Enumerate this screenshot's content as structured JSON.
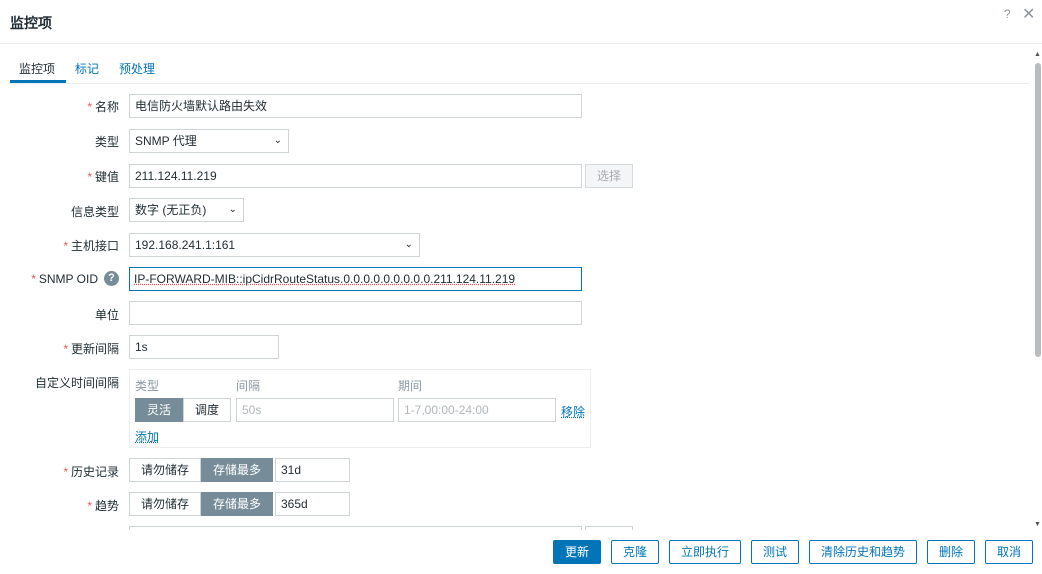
{
  "dialog": {
    "title": "监控项",
    "help_icon": "?",
    "close_icon": "✕"
  },
  "tabs": [
    {
      "label": "监控项",
      "active": true
    },
    {
      "label": "标记",
      "active": false
    },
    {
      "label": "预处理",
      "active": false
    }
  ],
  "form": {
    "name": {
      "label": "名称",
      "required": true,
      "value": "电信防火墙默认路由失效"
    },
    "type": {
      "label": "类型",
      "value": "SNMP 代理"
    },
    "key": {
      "label": "键值",
      "required": true,
      "value": "211.124.11.219",
      "select_button": "选择"
    },
    "value_type": {
      "label": "信息类型",
      "value": "数字 (无正负)"
    },
    "interface": {
      "label": "主机接口",
      "required": true,
      "value": "192.168.241.1:161"
    },
    "snmp_oid": {
      "label": "SNMP OID",
      "required": true,
      "value": "IP-FORWARD-MIB::ipCidrRouteStatus.0.0.0.0.0.0.0.0.0.211.124.11.219"
    },
    "units": {
      "label": "单位",
      "value": ""
    },
    "update_interval": {
      "label": "更新间隔",
      "required": true,
      "value": "1s"
    },
    "custom_intervals": {
      "label": "自定义时间间隔",
      "col_type": "类型",
      "col_interval": "间隔",
      "col_period": "期间",
      "flexible": "灵活",
      "scheduling": "调度",
      "interval_placeholder": "50s",
      "period_placeholder": "1-7,00:00-24:00",
      "remove_link": "移除",
      "add_link": "添加"
    },
    "history": {
      "label": "历史记录",
      "required": true,
      "opt_no_store": "请勿储存",
      "opt_store": "存储最多",
      "value": "31d"
    },
    "trends": {
      "label": "趋势",
      "required": true,
      "opt_no_store": "请勿储存",
      "opt_store": "存储最多",
      "value": "365d"
    }
  },
  "footer": {
    "update": "更新",
    "clone": "克隆",
    "execute_now": "立即执行",
    "test": "测试",
    "clear_history": "清除历史和趋势",
    "delete": "删除",
    "cancel": "取消"
  },
  "colors": {
    "accent": "#0275b8",
    "required": "#e45959",
    "toggle_on": "#768d99"
  }
}
